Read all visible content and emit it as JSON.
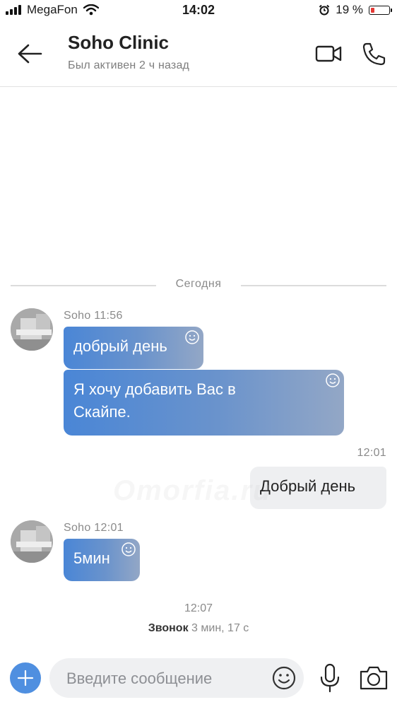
{
  "status_bar": {
    "carrier": "MegaFon",
    "time": "14:02",
    "battery_percent": "19 %",
    "battery_level": 0.19
  },
  "header": {
    "title": "Soho Clinic",
    "subtitle": "Был активен 2 ч назад",
    "icons": [
      "arrow-left-icon",
      "video-camera-icon",
      "phone-icon"
    ]
  },
  "divider": {
    "label": "Сегодня"
  },
  "messages": [
    {
      "meta": "Soho 11:56",
      "text": "добрый день",
      "direction": "incoming"
    },
    {
      "text": "Я хочу добавить Вас в Скайпе.",
      "direction": "incoming"
    },
    {
      "meta": "12:01",
      "text": "Добрый день",
      "direction": "outgoing"
    },
    {
      "meta": "Soho 12:01",
      "text": "5мин",
      "direction": "incoming"
    }
  ],
  "watermark": "Omorfia.ru",
  "call": {
    "time": "12:07",
    "label": "Звонок",
    "duration": "3 мин, 17 с"
  },
  "composer": {
    "placeholder": "Введите сообщение"
  },
  "colors": {
    "accent": "#4f8fe0",
    "bubble_start": "#4a86d6",
    "bubble_end": "#93a7c6",
    "outgoing_bubble": "#eeeff1"
  }
}
